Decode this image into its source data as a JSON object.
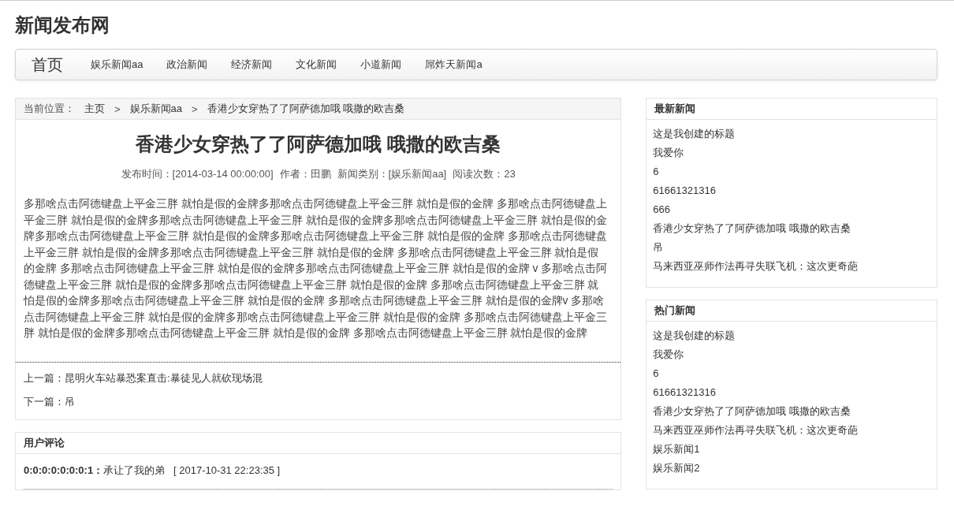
{
  "site_title": "新闻发布网",
  "nav": {
    "brand": "首页",
    "items": [
      "娱乐新闻aa",
      "政治新闻",
      "经济新闻",
      "文化新闻",
      "小道新闻",
      "屌炸天新闻a"
    ]
  },
  "breadcrumb": {
    "label": "当前位置：",
    "items": [
      {
        "text": "主页",
        "kind": "link"
      },
      {
        "text": ">",
        "kind": "separator"
      },
      {
        "text": "娱乐新闻aa",
        "kind": "link"
      },
      {
        "text": ">",
        "kind": "separator"
      },
      {
        "text": "香港少女穿热了了阿萨德加哦 哦撒的欧吉桑",
        "kind": "current"
      }
    ]
  },
  "article": {
    "title": "香港少女穿热了了阿萨德加哦 哦撒的欧吉桑",
    "meta": [
      "发布时间：[2014-03-14 00:00:00]",
      "作者：田鹏",
      "新闻类别：[娱乐新闻aa]",
      "阅读次数：23"
    ],
    "body": "多那啥点击阿德键盘上平金三胖 就怕是假的金牌多那啥点击阿德键盘上平金三胖 就怕是假的金牌 多那啥点击阿德键盘上平金三胖 就怕是假的金牌多那啥点击阿德键盘上平金三胖 就怕是假的金牌多那啥点击阿德键盘上平金三胖 就怕是假的金牌多那啥点击阿德键盘上平金三胖 就怕是假的金牌多那啥点击阿德键盘上平金三胖 就怕是假的金牌 多那啥点击阿德键盘上平金三胖 就怕是假的金牌多那啥点击阿德键盘上平金三胖 就怕是假的金牌 多那啥点击阿德键盘上平金三胖 就怕是假的金牌 多那啥点击阿德键盘上平金三胖 就怕是假的金牌多那啥点击阿德键盘上平金三胖 就怕是假的金牌 v 多那啥点击阿德键盘上平金三胖 就怕是假的金牌多那啥点击阿德键盘上平金三胖 就怕是假的金牌 多那啥点击阿德键盘上平金三胖 就怕是假的金牌多那啥点击阿德键盘上平金三胖 就怕是假的金牌 多那啥点击阿德键盘上平金三胖 就怕是假的金牌v 多那啥点击阿德键盘上平金三胖 就怕是假的金牌多那啥点击阿德键盘上平金三胖 就怕是假的金牌 多那啥点击阿德键盘上平金三胖 就怕是假的金牌多那啥点击阿德键盘上平金三胖 就怕是假的金牌 多那啥点击阿德键盘上平金三胖 就怕是假的金牌",
    "prev": {
      "label": "上一篇：",
      "title": "昆明火车站暴恐案直击:暴徒见人就砍现场混"
    },
    "next": {
      "label": "下一篇：",
      "title": "吊"
    }
  },
  "comments": {
    "title": "用户评论",
    "items": [
      "**0:0:0:0:0:0:0:1：**承让了我的弟   [ 2017-10-31 22:23:35 ]"
    ]
  },
  "sidebar": [
    {
      "title": "最新新闻",
      "items": [
        "这是我创建的标题",
        "我爱你",
        "6",
        "61661321316",
        "666",
        "香港少女穿热了了阿萨德加哦 哦撒的欧吉桑",
        "吊",
        "马来西亚巫师作法再寻失联飞机：这次更奇葩"
      ]
    },
    {
      "title": "热门新闻",
      "items": [
        "这是我创建的标题",
        "我爱你",
        "6",
        "61661321316",
        "香港少女穿热了了阿萨德加哦 哦撒的欧吉桑",
        "马来西亚巫师作法再寻失联飞机：这次更奇葩",
        "娱乐新闻1",
        "娱乐新闻2"
      ]
    }
  ]
}
